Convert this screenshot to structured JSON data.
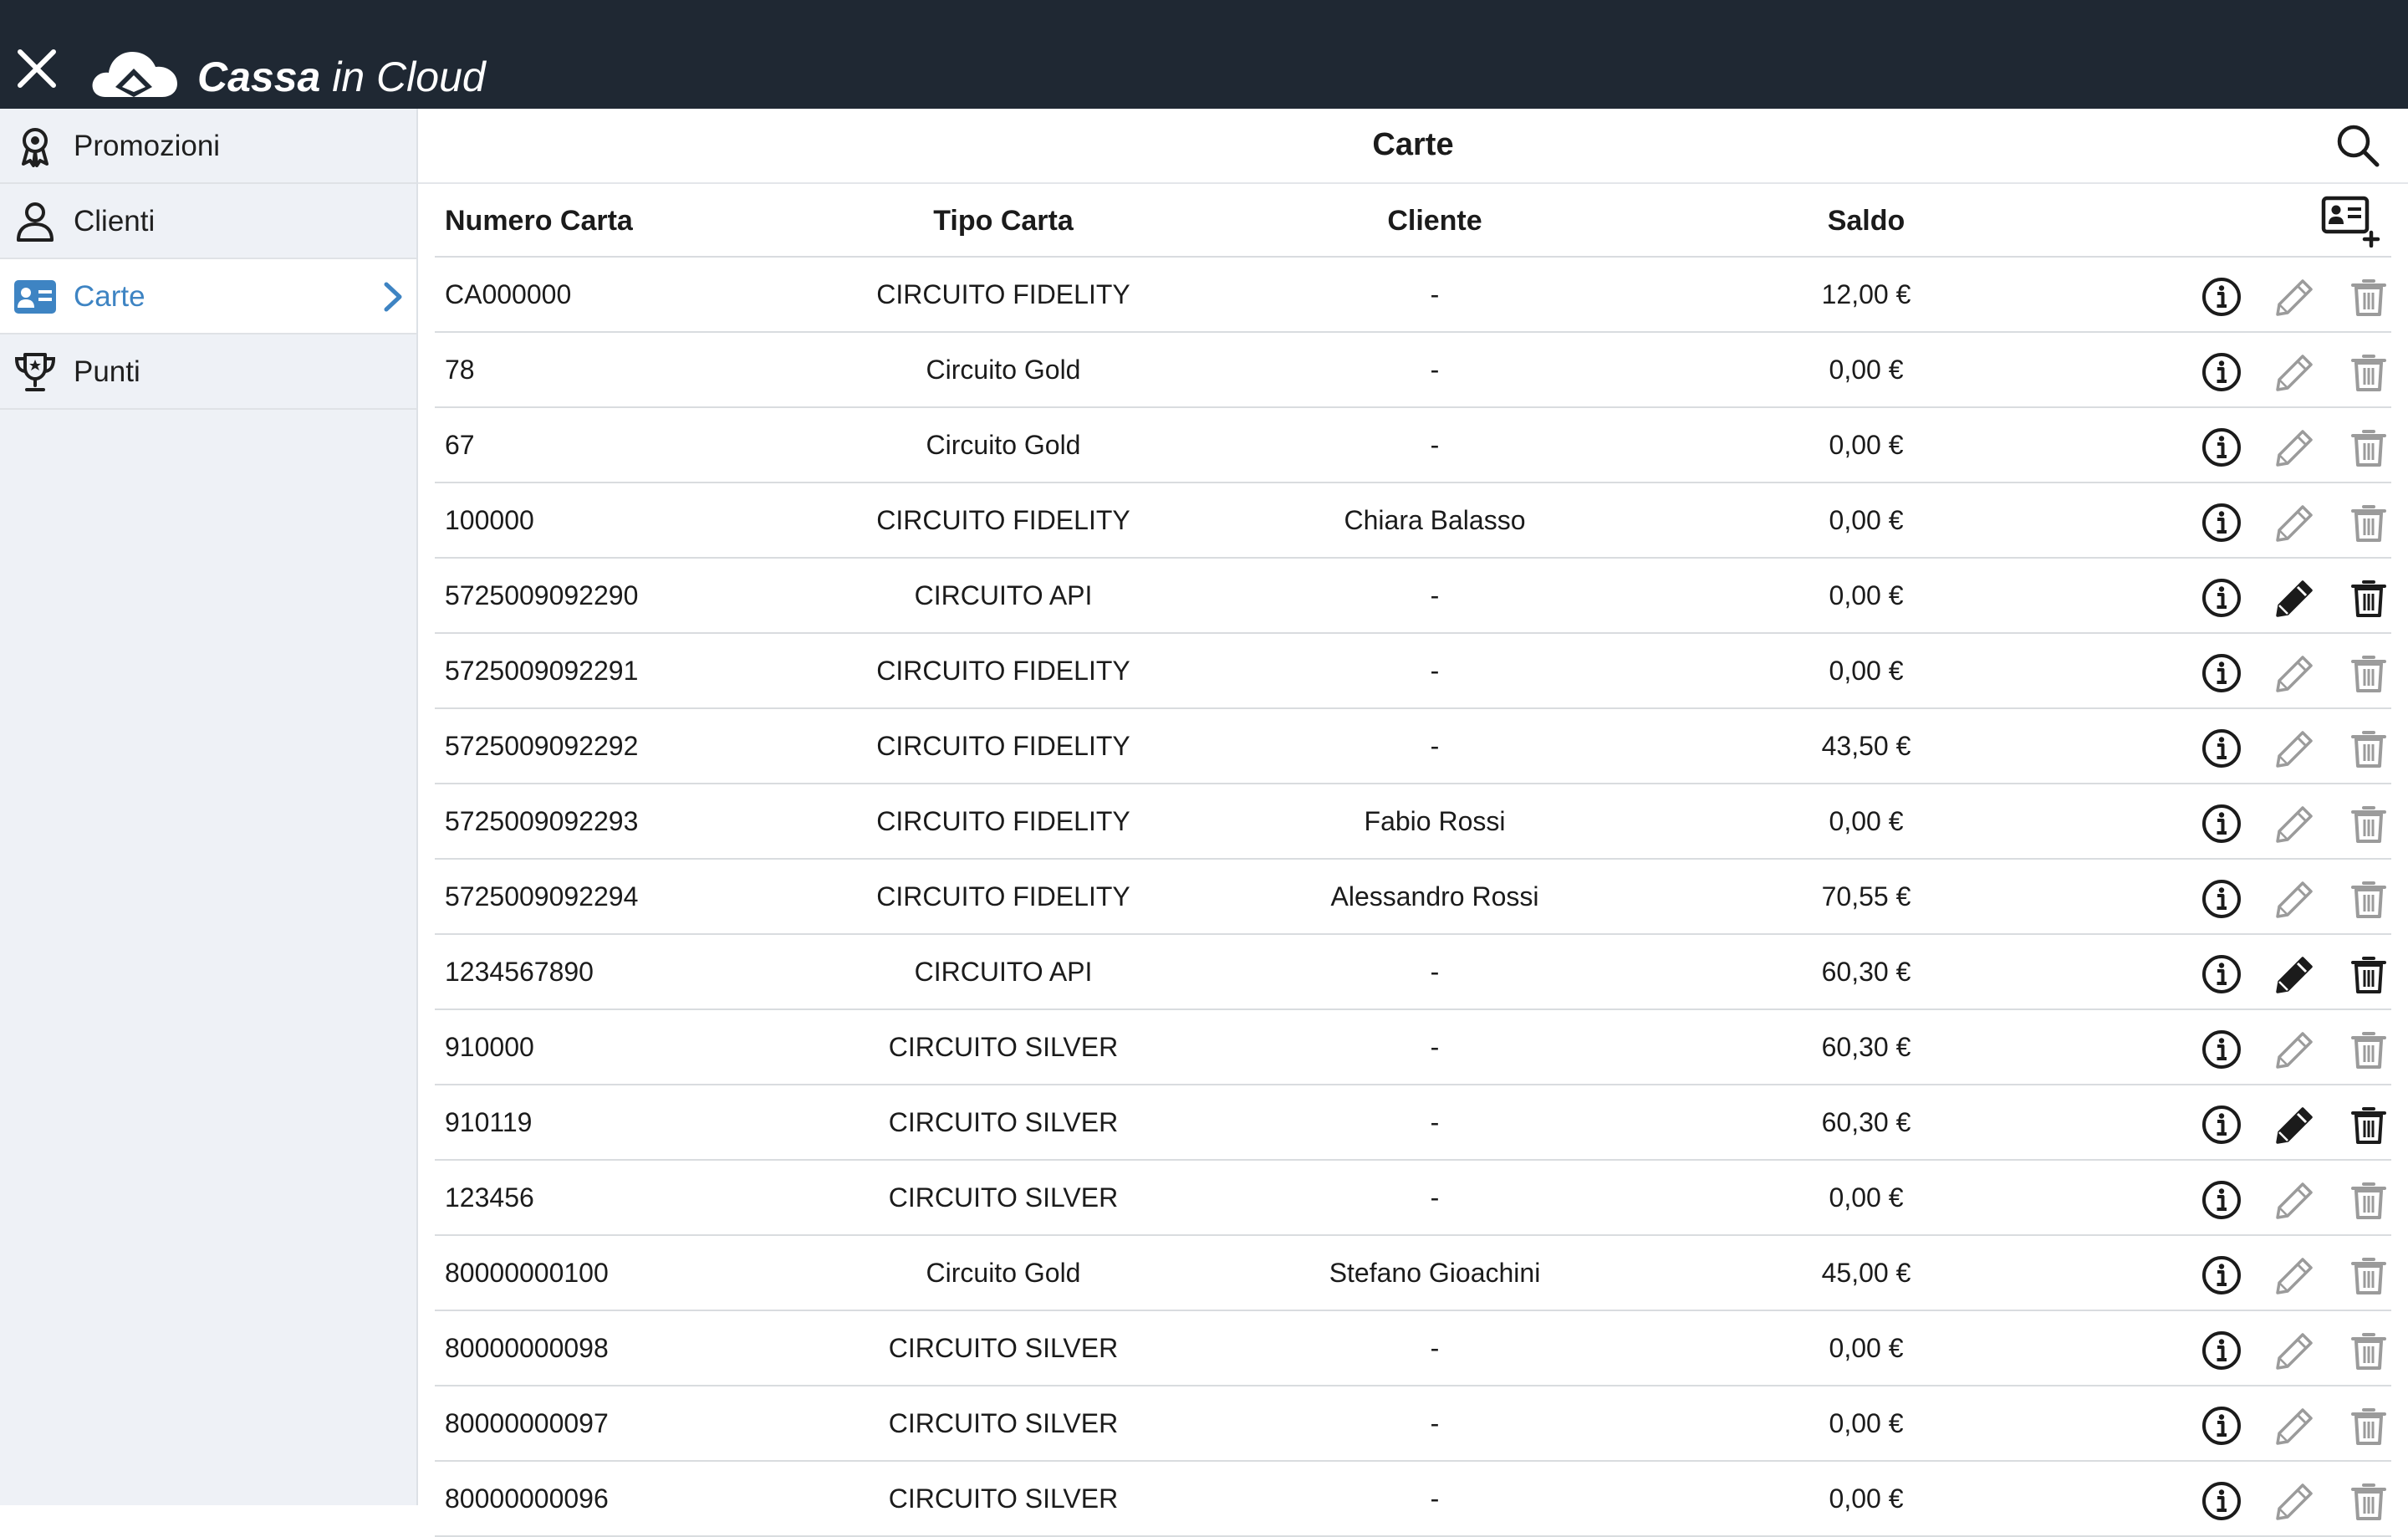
{
  "app": {
    "brand_bold": "Cassa",
    "brand_light": " in Cloud"
  },
  "sidebar": {
    "items": [
      {
        "label": "Promozioni",
        "icon": "award-ribbon-icon"
      },
      {
        "label": "Clienti",
        "icon": "user-icon"
      },
      {
        "label": "Carte",
        "icon": "id-card-icon",
        "active": true
      },
      {
        "label": "Punti",
        "icon": "trophy-icon"
      }
    ]
  },
  "main": {
    "title": "Carte"
  },
  "table": {
    "columns": [
      "Numero Carta",
      "Tipo Carta",
      "Cliente",
      "Saldo"
    ],
    "rows": [
      {
        "numero": "CA000000",
        "tipo": "CIRCUITO FIDELITY",
        "cliente": "-",
        "saldo": "12,00 €",
        "editable": false
      },
      {
        "numero": "78",
        "tipo": "Circuito Gold",
        "cliente": "-",
        "saldo": "0,00 €",
        "editable": false
      },
      {
        "numero": "67",
        "tipo": "Circuito Gold",
        "cliente": "-",
        "saldo": "0,00 €",
        "editable": false
      },
      {
        "numero": "100000",
        "tipo": "CIRCUITO FIDELITY",
        "cliente": "Chiara Balasso",
        "saldo": "0,00 €",
        "editable": false
      },
      {
        "numero": "5725009092290",
        "tipo": "CIRCUITO API",
        "cliente": "-",
        "saldo": "0,00 €",
        "editable": true
      },
      {
        "numero": "5725009092291",
        "tipo": "CIRCUITO FIDELITY",
        "cliente": "-",
        "saldo": "0,00 €",
        "editable": false
      },
      {
        "numero": "5725009092292",
        "tipo": "CIRCUITO FIDELITY",
        "cliente": "-",
        "saldo": "43,50 €",
        "editable": false
      },
      {
        "numero": "5725009092293",
        "tipo": "CIRCUITO FIDELITY",
        "cliente": "Fabio Rossi",
        "saldo": "0,00 €",
        "editable": false
      },
      {
        "numero": "5725009092294",
        "tipo": "CIRCUITO FIDELITY",
        "cliente": "Alessandro Rossi",
        "saldo": "70,55 €",
        "editable": false
      },
      {
        "numero": "1234567890",
        "tipo": "CIRCUITO API",
        "cliente": "-",
        "saldo": "60,30 €",
        "editable": true
      },
      {
        "numero": "910000",
        "tipo": "CIRCUITO SILVER",
        "cliente": "-",
        "saldo": "60,30 €",
        "editable": false
      },
      {
        "numero": "910119",
        "tipo": "CIRCUITO SILVER",
        "cliente": "-",
        "saldo": "60,30 €",
        "editable": true
      },
      {
        "numero": "123456",
        "tipo": "CIRCUITO SILVER",
        "cliente": "-",
        "saldo": "0,00 €",
        "editable": false
      },
      {
        "numero": "80000000100",
        "tipo": "Circuito Gold",
        "cliente": "Stefano Gioachini",
        "saldo": "45,00 €",
        "editable": false
      },
      {
        "numero": "80000000098",
        "tipo": "CIRCUITO SILVER",
        "cliente": "-",
        "saldo": "0,00 €",
        "editable": false
      },
      {
        "numero": "80000000097",
        "tipo": "CIRCUITO SILVER",
        "cliente": "-",
        "saldo": "0,00 €",
        "editable": false
      },
      {
        "numero": "80000000096",
        "tipo": "CIRCUITO SILVER",
        "cliente": "-",
        "saldo": "0,00 €",
        "editable": false
      }
    ]
  },
  "icons": {
    "close": "close-icon",
    "logo": "cloud-logo-icon",
    "search": "search-icon",
    "add_card": "add-card-icon",
    "info": "info-icon",
    "edit": "pencil-icon",
    "delete": "trash-icon",
    "chevron": "chevron-right-icon"
  },
  "colors": {
    "topbar": "#1f2833",
    "accent": "#3e84c3",
    "sidebar_bg": "#eef1f6",
    "icon_dark": "#1b1b1b",
    "icon_disabled": "#9b9b9b"
  }
}
